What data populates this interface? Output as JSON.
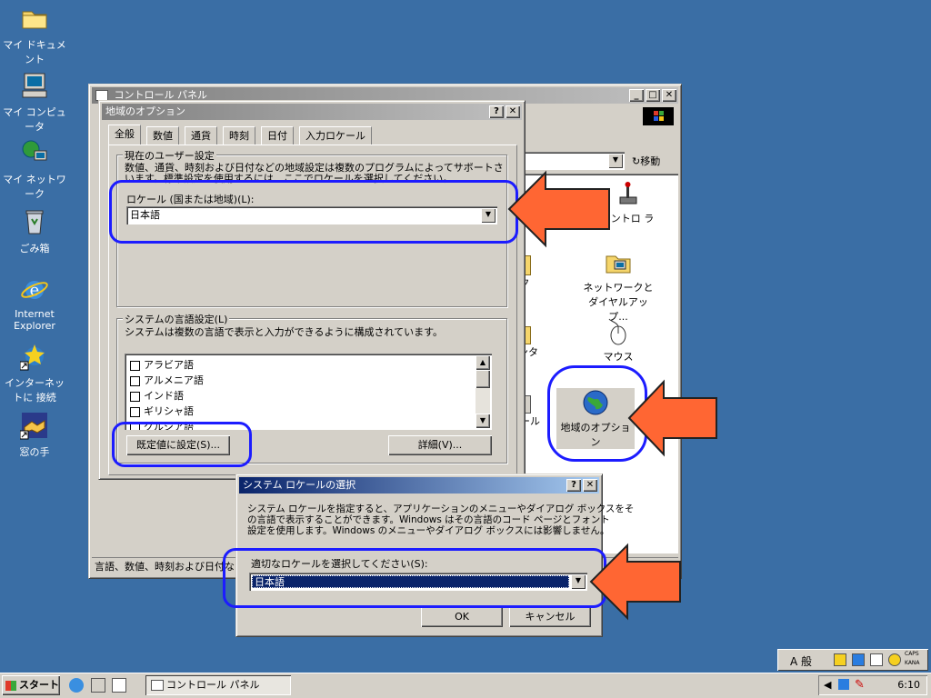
{
  "desktop": {
    "icons": [
      {
        "label": "マイ ドキュメント"
      },
      {
        "label": "マイ コンピュータ"
      },
      {
        "label": "マイ ネットワーク"
      },
      {
        "label": "ごみ箱"
      },
      {
        "label": "Internet Explorer"
      },
      {
        "label": "インターネットに 接続"
      },
      {
        "label": "窓の手"
      }
    ]
  },
  "control_panel": {
    "title": "コントロール パネル",
    "address_go": "移動",
    "status": "言語、数値、時刻および日付などの地域設定を変更します。",
    "icons": [
      {
        "label": "コントロ ラ"
      },
      {
        "label": "ク"
      },
      {
        "label": "ネットワークとダイヤルアップ..."
      },
      {
        "label": "ンタ"
      },
      {
        "label": "マウス"
      },
      {
        "label": "ール"
      },
      {
        "label": "地域のオプション"
      }
    ]
  },
  "regional": {
    "title": "地域のオプション",
    "tabs": [
      "全般",
      "数値",
      "通貨",
      "時刻",
      "日付",
      "入力ロケール"
    ],
    "user_group_label": "現在のユーザー設定",
    "user_desc1": "数値、通貨、時刻および日付などの地域設定は複数のプログラムによってサポートされて",
    "user_desc2": "います。標準設定を使用するには、ここでロケールを選択してください。",
    "locale_label": "ロケール (国または地域)(L):",
    "locale_value": "日本語",
    "system_group_label": "システムの言語設定(L)",
    "system_desc": "システムは複数の言語で表示と入力ができるように構成されています。",
    "languages": [
      "アラビア語",
      "アルメニア語",
      "インド語",
      "ギリシャ語",
      "グルジア語"
    ],
    "default_button": "既定値に設定(S)...",
    "details_button": "詳細(V)..."
  },
  "syslocale": {
    "title": "システム ロケールの選択",
    "desc1": "システム ロケールを指定すると、アプリケーションのメニューやダイアログ ボックスをそ",
    "desc2": "の言語で表示することができます。Windows はその言語のコード ページとフォント",
    "desc3": "設定を使用します。Windows のメニューやダイアログ ボックスには影響しません。",
    "select_label": "適切なロケールを選択してください(S):",
    "select_value": "日本語",
    "ok": "OK",
    "cancel": "キャンセル"
  },
  "taskbar": {
    "start": "スタート",
    "task": "コントロール パネル",
    "clock": "6:10",
    "ime": "A 般",
    "caps": "CAPS",
    "kana": "KANA"
  },
  "colors": {
    "desktop": "#3a6ea5",
    "active_title": "#0a246a",
    "highlight": "#1c1cff",
    "arrow": "#ff6633"
  }
}
